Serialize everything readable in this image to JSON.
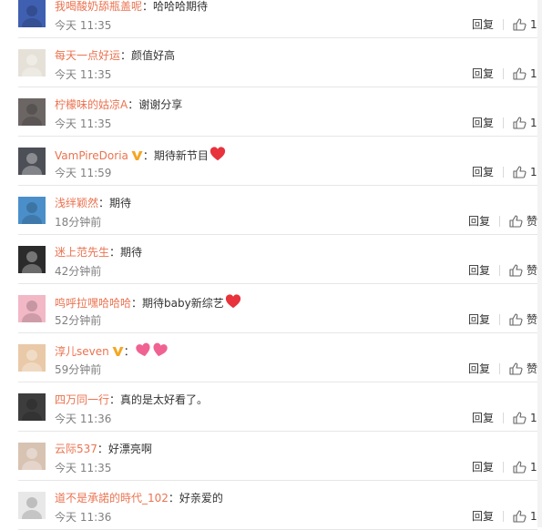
{
  "comments": [
    {
      "user": "我喝酸奶舔瓶盖呢",
      "text": "哈哈哈期待",
      "vip": false,
      "emoji": "",
      "time": "今天 11:35",
      "reply": "回复",
      "like": "1",
      "avatar": "#3f5fb0"
    },
    {
      "user": "每天一点好运",
      "text": "颜值好高",
      "vip": false,
      "emoji": "",
      "time": "今天 11:35",
      "reply": "回复",
      "like": "1",
      "avatar": "#e6e1d8"
    },
    {
      "user": "柠檬味的姑凉A",
      "text": "谢谢分享",
      "vip": false,
      "emoji": "",
      "time": "今天 11:35",
      "reply": "回复",
      "like": "1",
      "avatar": "#6b6664"
    },
    {
      "user": "VamPireDoria",
      "text": "期待新节目",
      "vip": true,
      "emoji": "heart",
      "time": "今天 11:59",
      "reply": "回复",
      "like": "1",
      "avatar": "#4c4f56"
    },
    {
      "user": "浅绊颖然",
      "text": "期待",
      "vip": false,
      "emoji": "",
      "time": "18分钟前",
      "reply": "回复",
      "like": "赞",
      "avatar": "#4a8fc9"
    },
    {
      "user": "迷上范先生",
      "text": "期待",
      "vip": false,
      "emoji": "",
      "time": "42分钟前",
      "reply": "回复",
      "like": "赞",
      "avatar": "#2b2b2b"
    },
    {
      "user": "鸣呼拉嘿哈哈哈",
      "text": "期待baby新综艺",
      "vip": false,
      "emoji": "heart",
      "time": "52分钟前",
      "reply": "回复",
      "like": "赞",
      "avatar": "#f2b8c6"
    },
    {
      "user": "淳儿seven",
      "text": "",
      "vip": true,
      "emoji": "hearts",
      "time": "59分钟前",
      "reply": "回复",
      "like": "赞",
      "avatar": "#e9c9a8"
    },
    {
      "user": "四万同一行",
      "text": "真的是太好看了。",
      "vip": false,
      "emoji": "",
      "time": "今天 11:36",
      "reply": "回复",
      "like": "1",
      "avatar": "#3d3d3d"
    },
    {
      "user": "云际537",
      "text": "好漂亮啊",
      "vip": false,
      "emoji": "",
      "time": "今天 11:35",
      "reply": "回复",
      "like": "1",
      "avatar": "#d8c2b2"
    },
    {
      "user": "道不是承諾的時代_102",
      "text": "好亲爱的",
      "vip": false,
      "emoji": "",
      "time": "今天 11:36",
      "reply": "回复",
      "like": "1",
      "avatar": "#e8e8e8"
    }
  ],
  "colors": {
    "username": "#eb7350",
    "text": "#333333",
    "time": "#808080",
    "heart": "#e8323c",
    "vip": "#f5a623"
  },
  "icons": {
    "like": "thumbs-up-icon",
    "vip": "vip-badge-icon",
    "heart": "heart-emoji-icon"
  }
}
